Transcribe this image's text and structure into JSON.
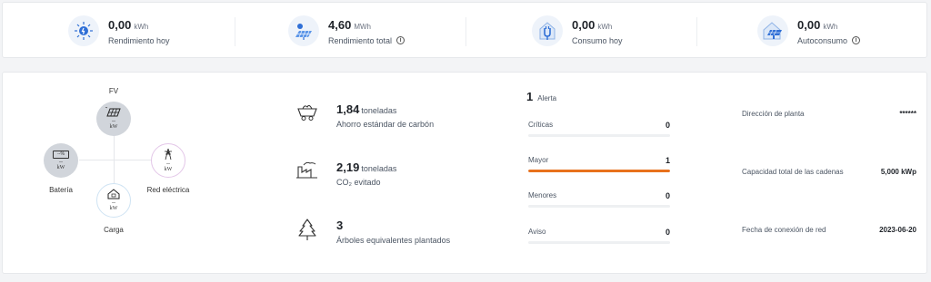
{
  "kpis": [
    {
      "value": "0,00",
      "unit": "kWh",
      "label": "Rendimiento hoy",
      "icon": "sun-energy-icon",
      "info": false
    },
    {
      "value": "4,60",
      "unit": "MWh",
      "label": "Rendimiento total",
      "icon": "solar-panel-icon",
      "info": true
    },
    {
      "value": "0,00",
      "unit": "kWh",
      "label": "Consumo hoy",
      "icon": "plug-consumption-icon",
      "info": false
    },
    {
      "value": "0,00",
      "unit": "kWh",
      "label": "Autoconsumo",
      "icon": "house-solar-icon",
      "info": true
    }
  ],
  "flow": {
    "pv": {
      "label": "FV",
      "value": "--",
      "unit": "kW"
    },
    "battery": {
      "label": "Batería",
      "value": "--",
      "unit": "kW",
      "badge": "--%"
    },
    "grid": {
      "label": "Red eléctrica",
      "value": "--",
      "unit": "kW"
    },
    "load": {
      "label": "Carga",
      "value": "--",
      "unit": "kW"
    }
  },
  "environment": [
    {
      "value": "1,84",
      "unit": "toneladas",
      "label": "Ahorro estándar de carbón",
      "icon": "coal-cart-icon"
    },
    {
      "value": "2,19",
      "unit": "toneladas",
      "label": "CO₂ evitado",
      "icon": "factory-icon"
    },
    {
      "value": "3",
      "unit": "",
      "label": "Árboles equivalentes plantados",
      "icon": "tree-icon"
    }
  ],
  "alerts": {
    "total": "1",
    "label": "Alerta",
    "levels": [
      {
        "name": "Críticas",
        "count": "0",
        "fraction": 0
      },
      {
        "name": "Mayor",
        "count": "1",
        "fraction": 1
      },
      {
        "name": "Menores",
        "count": "0",
        "fraction": 0
      },
      {
        "name": "Aviso",
        "count": "0",
        "fraction": 0
      }
    ]
  },
  "details": [
    {
      "label": "Dirección de planta",
      "value": "******"
    },
    {
      "label": "Capacidad total de las cadenas",
      "value": "5,000 kWp"
    },
    {
      "label": "Fecha de conexión de red",
      "value": "2023-06-20"
    }
  ],
  "colors": {
    "accent": "#e8711c",
    "icon_blue": "#2f6fd6"
  }
}
